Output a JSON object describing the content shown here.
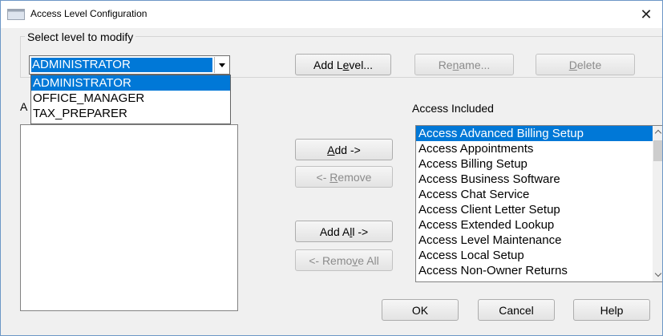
{
  "window": {
    "title": "Access Level Configuration",
    "close_glyph": "✕"
  },
  "group": {
    "legend": "Select level to modify"
  },
  "level_combo": {
    "value": "ADMINISTRATOR",
    "options": [
      "ADMINISTRATOR",
      "OFFICE_MANAGER",
      "TAX_PREPARER"
    ]
  },
  "buttons": {
    "add_level": {
      "pre": "Add L",
      "accel": "e",
      "post": "vel..."
    },
    "rename": {
      "pre": "Re",
      "accel": "n",
      "post": "ame..."
    },
    "delete": {
      "pre": "",
      "accel": "D",
      "post": "elete"
    },
    "add": {
      "pre": "",
      "accel": "A",
      "post": "dd ->"
    },
    "remove": {
      "pre": "<- ",
      "accel": "R",
      "post": "emove"
    },
    "add_all": {
      "pre": "Add A",
      "accel": "l",
      "post": "l ->"
    },
    "remove_all": {
      "pre": "<- Remo",
      "accel": "v",
      "post": "e All"
    },
    "ok": "OK",
    "cancel": "Cancel",
    "help": "Help"
  },
  "available": {
    "label_visible": "A",
    "items": []
  },
  "included": {
    "label": "Access Included",
    "items": [
      "Access Advanced Billing Setup",
      "Access Appointments",
      "Access Billing Setup",
      "Access Business Software",
      "Access Chat Service",
      "Access Client Letter Setup",
      "Access Extended Lookup",
      "Access Level Maintenance",
      "Access Local Setup",
      "Access Non-Owner Returns"
    ],
    "selected_index": 0
  },
  "icons": {
    "app": "window-icon",
    "scroll_up": "chevron-up-icon",
    "scroll_down": "chevron-down-icon",
    "combo_arrow": "caret-down-icon"
  },
  "colors": {
    "selection": "#0078d7",
    "dialog_bg": "#f0f0f0",
    "window_border": "#6d97c6",
    "disabled_text": "#8b8b8b"
  }
}
